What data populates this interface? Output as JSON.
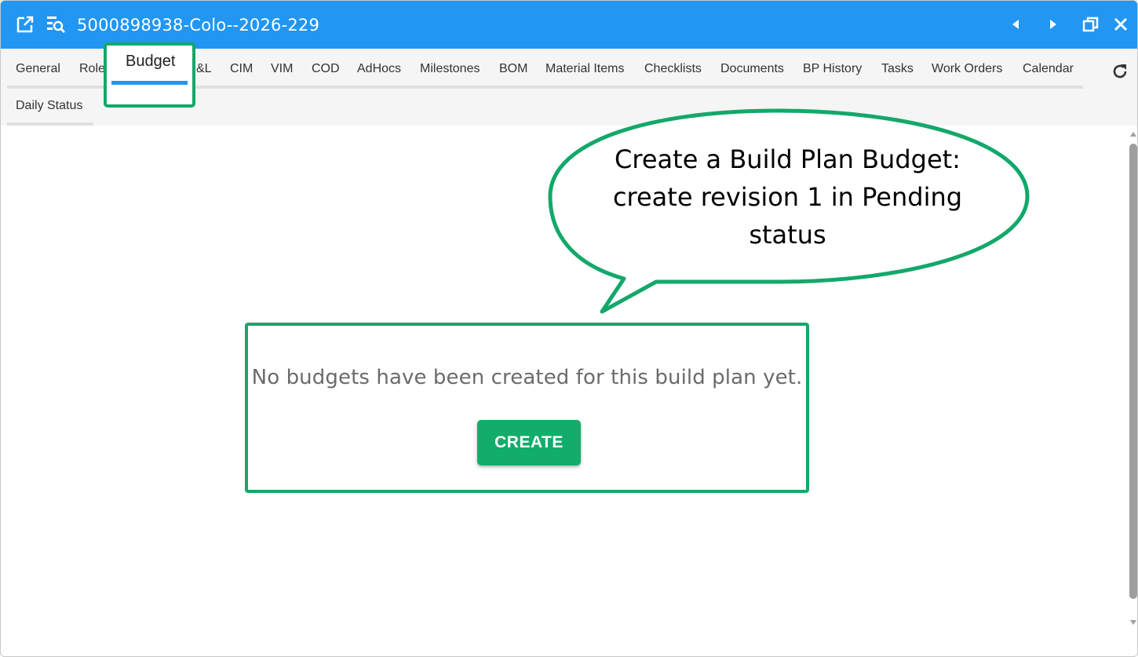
{
  "window": {
    "title": "5000898938-Colo--2026-229",
    "icons": [
      "open-external-icon",
      "search-list-icon",
      "chevron-left-icon",
      "chevron-right-icon",
      "restore-window-icon",
      "close-icon"
    ]
  },
  "tabs": {
    "row1": [
      {
        "label": "General"
      },
      {
        "label": "Role"
      },
      {
        "label": "Budget",
        "active": true
      },
      {
        "label": "&L"
      },
      {
        "label": "CIM"
      },
      {
        "label": "VIM"
      },
      {
        "label": "COD"
      },
      {
        "label": "AdHocs"
      },
      {
        "label": "Milestones"
      },
      {
        "label": "BOM"
      },
      {
        "label": "Material Items"
      },
      {
        "label": "Checklists"
      },
      {
        "label": "Documents"
      },
      {
        "label": "BP History"
      },
      {
        "label": "Tasks"
      },
      {
        "label": "Work Orders"
      },
      {
        "label": "Calendar"
      }
    ],
    "row2": [
      {
        "label": "Daily Status"
      }
    ]
  },
  "callout": {
    "text": "Create a Build Plan Budget: create revision 1 in Pending status",
    "line1": "Create a Build Plan Budget:",
    "line2": "create revision 1 in Pending",
    "line3": "status"
  },
  "empty_state": {
    "message": "No budgets have been created for this build plan yet.",
    "create_label": "CREATE"
  },
  "colors": {
    "titlebar": "#2196f3",
    "accent_green": "#13a86a",
    "active_tab": "#2196f3"
  }
}
